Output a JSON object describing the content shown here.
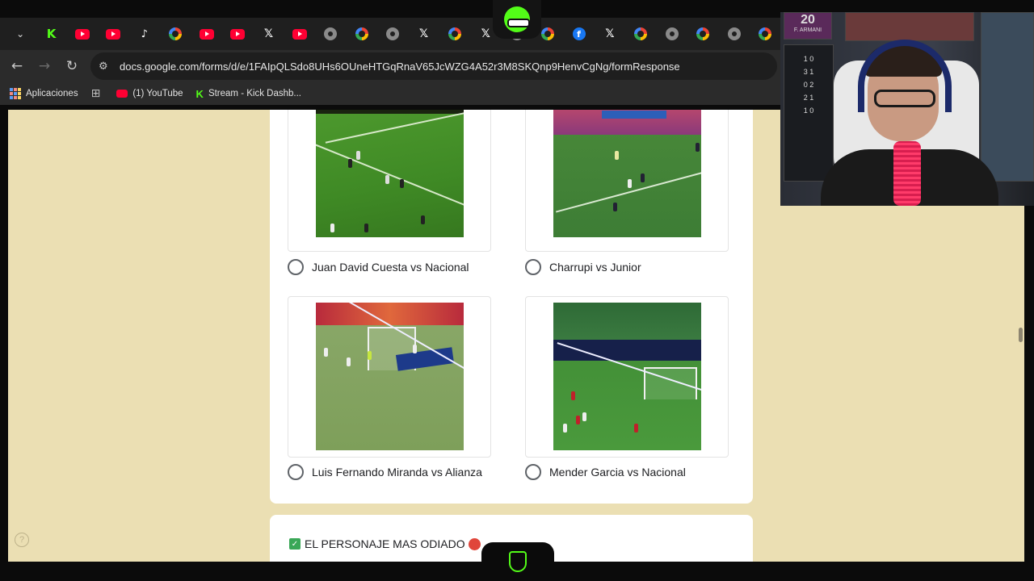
{
  "browser": {
    "url": "docs.google.com/forms/d/e/1FAIpQLSdo8UHs6OUneHTGqRnaV65JcWZG4A52r3M8SKQnp9HenvCgNg/formResponse",
    "tabs": [
      "tab-menu",
      "kick",
      "youtube",
      "youtube",
      "tiktok",
      "google",
      "youtube",
      "youtube",
      "x",
      "youtube",
      "chrome-gray",
      "google",
      "globe-gray",
      "x",
      "google",
      "x",
      "logo",
      "google",
      "facebook",
      "x",
      "google",
      "globe-gray",
      "google",
      "globe-gray",
      "google"
    ],
    "bookmarks": {
      "apps_label": "Aplicaciones",
      "youtube_label": "(1) YouTube",
      "kick_label": "Stream - Kick Dashb..."
    }
  },
  "form": {
    "options": [
      {
        "label": "Juan David Cuesta vs Nacional"
      },
      {
        "label": "Charrupi vs Junior"
      },
      {
        "label": "Luis Fernando Miranda vs Alianza"
      },
      {
        "label": "Mender Garcia vs Nacional"
      }
    ],
    "next_question": "EL PERSONAJE MAS ODIADO"
  },
  "webcam": {
    "poster_number": "20",
    "poster_name": "F. ARMANI",
    "scores": [
      "1 0",
      "3 1",
      "0 2",
      "2 1",
      "1 0"
    ]
  },
  "colors": {
    "page_bg": "#ebdfb3",
    "kick_green": "#53fc18",
    "card_bg": "#ffffff"
  }
}
